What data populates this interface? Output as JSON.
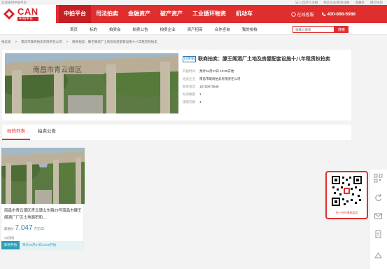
{
  "topbar": {
    "welcome": "欢迎来到中拍平台",
    "links": [
      "法人/自然人注册",
      "拍卖企业/机构注册",
      "收藏夹",
      "网页导航"
    ]
  },
  "logo": {
    "brand": "CAN",
    "sub": "中拍平台"
  },
  "main_nav": [
    "中拍平台",
    "司法拍卖",
    "金融资产",
    "破产资产",
    "工业循环物资",
    "机动车"
  ],
  "header": {
    "online_service": "在线客服",
    "phone": "400-898-5988"
  },
  "sub_nav": [
    "首页",
    "标的",
    "拍卖会",
    "拍卖公告",
    "拍卖企业",
    "资产招商",
    "合作咨询",
    "我的参拍"
  ],
  "search": {
    "placeholder": "请输入搜索",
    "button": "搜索"
  },
  "breadcrumb": [
    "拍卖会",
    "南昌市联商拍卖有限责任公司",
    "联商拍卖：滕王阁酒厂土地及房屋配套设施十八年租赁权拍卖"
  ],
  "auction": {
    "tag": "同步拍",
    "title": "联商拍卖：滕王阁酒厂土地及房屋配套设施十八年租赁权拍卖",
    "rows": [
      {
        "k": "开拍时间",
        "v": "预计04月27日  10:00开始"
      },
      {
        "k": "拍卖企业",
        "v": "南昌市联商拍卖有限责任公司"
      },
      {
        "k": "联系电话",
        "v": "15720073646"
      },
      {
        "k": "标的数量",
        "v": "1"
      },
      {
        "k": "围观次数",
        "v": "4"
      }
    ],
    "photo_text": "南昌市青云谱区"
  },
  "tabs": [
    "标的列表",
    "拍卖公告"
  ],
  "lot": {
    "title": "南昌市青云谱区青云谱山东路29号南昌市滕王阁酒厂厂区土地面积和...",
    "start_label": "起拍价",
    "price": "7.047",
    "unit": "万元/年",
    "views": "0次围观",
    "status": "即将开拍",
    "time": "预计04月27日10:00开始"
  },
  "qr": {
    "caption": "扫一扫分享拍卖会"
  },
  "colors": {
    "brand_red": "#e02d2d",
    "teal": "#2ba0b9"
  }
}
